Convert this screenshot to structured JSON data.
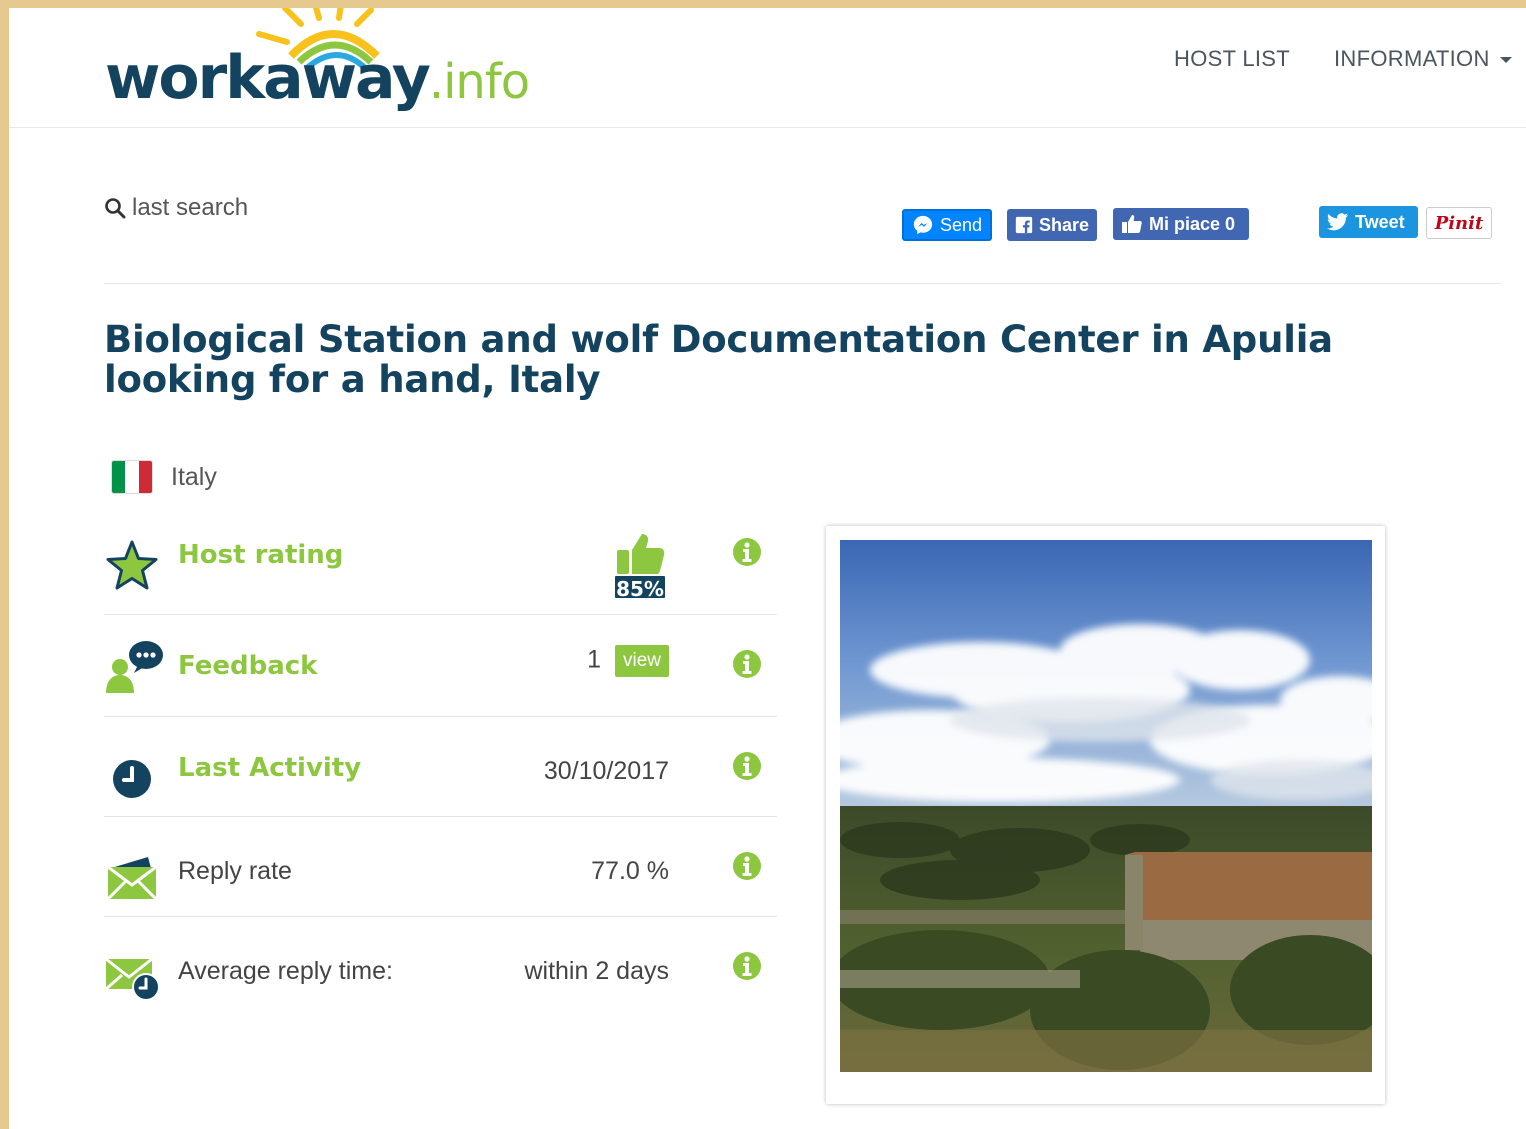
{
  "brand": {
    "main": "workaway",
    "tld": ".info"
  },
  "nav": {
    "host_list": "HOST LIST",
    "information": "INFORMATION"
  },
  "search": {
    "last_search": "last search"
  },
  "share": {
    "send": "Send",
    "share": "Share",
    "like": "Mi piace 0",
    "tweet": "Tweet",
    "pin": "Pinit"
  },
  "title": "Biological Station and wolf Documentation Center in Apulia looking for a hand, Italy",
  "country": {
    "name": "Italy",
    "flag_colors": [
      "#009246",
      "#ffffff",
      "#ce2b37"
    ]
  },
  "stats": {
    "host_rating": {
      "label": "Host rating",
      "percent": "85%"
    },
    "feedback": {
      "label": "Feedback",
      "count": "1",
      "view": "view"
    },
    "last_activity": {
      "label": "Last Activity",
      "value": "30/10/2017"
    },
    "reply_rate": {
      "label": "Reply rate",
      "value": "77.0 %"
    },
    "avg_reply": {
      "label": "Average reply time:",
      "value": "within 2 days"
    }
  },
  "colors": {
    "brand_navy": "#14435f",
    "brand_green": "#8dc63f",
    "facebook": "#4267b2",
    "messenger": "#0084ff",
    "twitter": "#1b95e0",
    "pinterest": "#bd081c"
  }
}
